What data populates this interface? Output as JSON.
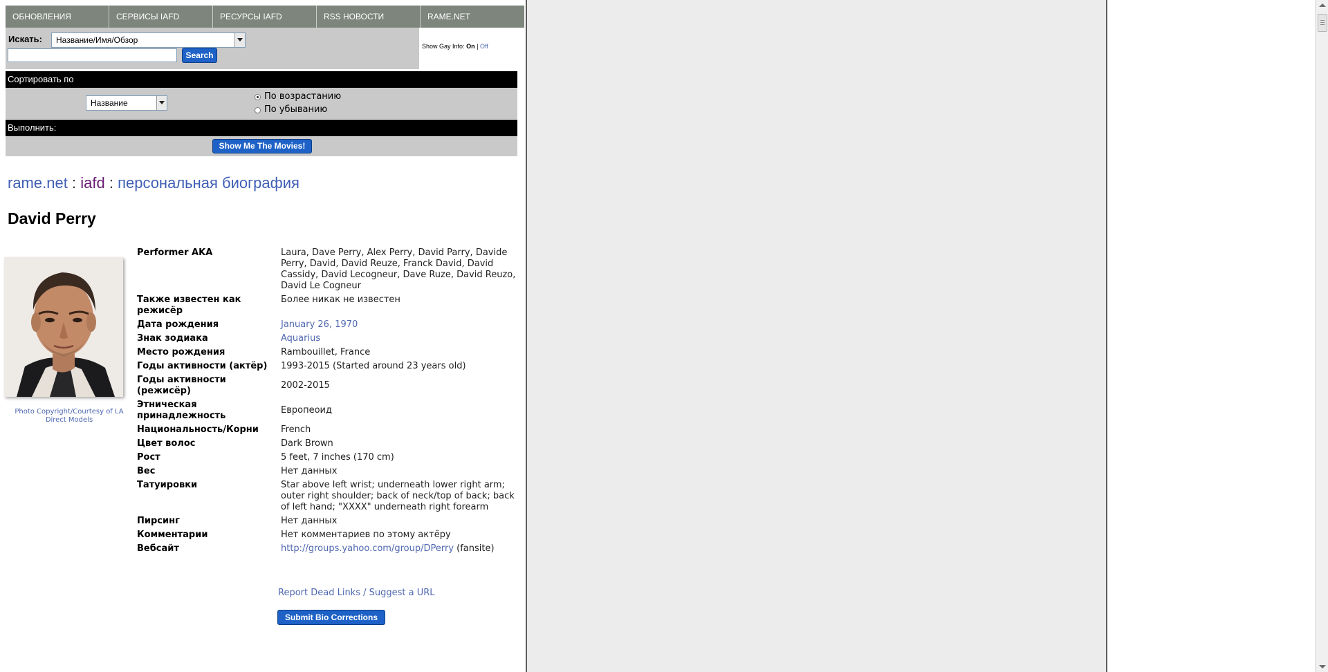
{
  "nav": {
    "items": [
      "ОБНОВЛЕНИЯ",
      "СЕРВИСЫ IAFD",
      "РЕСУРСЫ IAFD",
      "RSS НОВОСТИ",
      "RAME.NET"
    ]
  },
  "search": {
    "label": "Искать:",
    "field_selected": "Название/Имя/Обзор",
    "input_value": "",
    "button": "Search",
    "gay_info_label": "Show Gay Info:",
    "gay_on": "On",
    "gay_sep": "|",
    "gay_off": "Off"
  },
  "sort": {
    "header": "Сортировать по",
    "field_selected": "Название",
    "asc_label": "По возрастанию",
    "desc_label": "По убыванию",
    "asc_checked": true
  },
  "execute": {
    "header": "Выполнить:",
    "button": "Show Me The Movies!"
  },
  "breadcrumb": {
    "site": "rame.net",
    "sep1": ":",
    "section": "iafd",
    "sep2": ":",
    "page": "персональная биография"
  },
  "performer": {
    "name": "David Perry",
    "photo_credit": "Photo Copyright/Courtesy of LA Direct Models"
  },
  "bio": {
    "aka_label": "Performer AKA",
    "aka_value": "Laura, Dave Perry, Alex Perry, David Parry, Davide Perry, David, David Reuze, Franck David, David Cassidy, David Lecogneur, Dave Ruze, David Reuzo, David Le Cogneur",
    "director_label": "Также известен как режисёр",
    "director_value": "Более никак не известен",
    "birthday_label": "Дата рождения",
    "birthday_value": "January 26, 1970",
    "zodiac_label": "Знак зодиака",
    "zodiac_value": "Aquarius",
    "birthplace_label": "Место рождения",
    "birthplace_value": "Rambouillet, France",
    "years_actor_label": "Годы активности (актёр)",
    "years_actor_value": "1993-2015 (Started around 23 years old)",
    "years_director_label": "Годы активности (режисёр)",
    "years_director_value": "2002-2015",
    "ethnicity_label": "Этническая принадлежность",
    "ethnicity_value": "Европеоид",
    "nationality_label": "Национальность/Корни",
    "nationality_value": "French",
    "hair_label": "Цвет волос",
    "hair_value": "Dark Brown",
    "height_label": "Рост",
    "height_value": "5 feet, 7 inches (170 cm)",
    "weight_label": "Вес",
    "weight_value": "Нет данных",
    "tattoos_label": "Татуировки",
    "tattoos_value": "Star above left wrist; underneath lower right arm; outer right shoulder; back of neck/top of back; back of left hand; \"XXXX\" underneath right forearm",
    "piercings_label": "Пирсинг",
    "piercings_value": "Нет данных",
    "comments_label": "Комментарии",
    "comments_value": "Нет комментариев по этому актёру",
    "website_label": "Вебсайт",
    "website_url": "http://groups.yahoo.com/group/DPerry",
    "website_note": "(fansite)"
  },
  "actions": {
    "report": "Report Dead Links / Suggest a URL",
    "submit": "Submit Bio Corrections"
  },
  "colors": {
    "nav_bg": "#7d857c",
    "panel_gray": "#c9c9c9",
    "link_blue": "#4e68b0",
    "button_blue": "#1e62c7",
    "mid_pane": "#ececec"
  }
}
